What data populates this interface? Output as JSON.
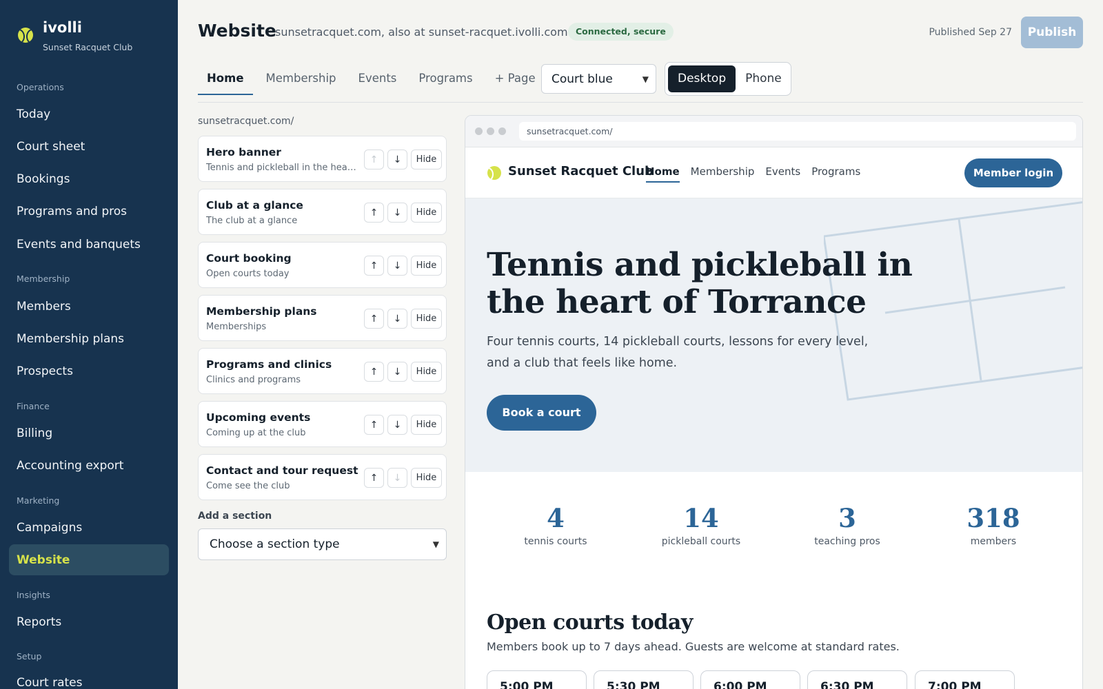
{
  "app": {
    "brand_name": "ivolli",
    "club_name": "Sunset Racquet Club"
  },
  "sidebar": {
    "groups": [
      "Operations",
      "Membership",
      "Finance",
      "Marketing",
      "Insights",
      "Setup"
    ],
    "items": [
      {
        "label": "Today",
        "active": false
      },
      {
        "label": "Court sheet",
        "active": false
      },
      {
        "label": "Bookings",
        "active": false
      },
      {
        "label": "Programs and pros",
        "active": false
      },
      {
        "label": "Events and banquets",
        "active": false
      },
      {
        "label": "Members",
        "active": false
      },
      {
        "label": "Membership plans",
        "active": false
      },
      {
        "label": "Prospects",
        "active": false
      },
      {
        "label": "Billing",
        "active": false
      },
      {
        "label": "Accounting export",
        "active": false
      },
      {
        "label": "Campaigns",
        "active": false
      },
      {
        "label": "Website",
        "active": true
      },
      {
        "label": "Reports",
        "active": false
      },
      {
        "label": "Court rates",
        "active": false
      }
    ]
  },
  "header": {
    "title": "Website",
    "domains": "sunsetracquet.com, also at sunset-racquet.ivolli.com",
    "status": "Connected, secure",
    "published": "Published Sep 27",
    "publish_label": "Publish"
  },
  "page_tabs": [
    {
      "label": "Home",
      "active": true
    },
    {
      "label": "Membership",
      "active": false
    },
    {
      "label": "Events",
      "active": false
    },
    {
      "label": "Programs",
      "active": false
    },
    {
      "label": "+ Page",
      "active": false
    }
  ],
  "theme": {
    "selected": "Court blue"
  },
  "view_toggle": {
    "options": [
      {
        "label": "Desktop",
        "active": true
      },
      {
        "label": "Phone",
        "active": false
      }
    ]
  },
  "sections": {
    "path": "sunsetracquet.com/",
    "hide_label": "Hide",
    "items": [
      {
        "title": "Hero banner",
        "subtitle": "Tennis and pickleball in the heart o...",
        "can_up": false,
        "can_down": true
      },
      {
        "title": "Club at a glance",
        "subtitle": "The club at a glance",
        "can_up": true,
        "can_down": true
      },
      {
        "title": "Court booking",
        "subtitle": "Open courts today",
        "can_up": true,
        "can_down": true
      },
      {
        "title": "Membership plans",
        "subtitle": "Memberships",
        "can_up": true,
        "can_down": true
      },
      {
        "title": "Programs and clinics",
        "subtitle": "Clinics and programs",
        "can_up": true,
        "can_down": true
      },
      {
        "title": "Upcoming events",
        "subtitle": "Coming up at the club",
        "can_up": true,
        "can_down": true
      },
      {
        "title": "Contact and tour request",
        "subtitle": "Come see the club",
        "can_up": true,
        "can_down": false
      }
    ],
    "add_label": "Add a section",
    "add_placeholder": "Choose a section type"
  },
  "preview": {
    "url": "sunsetracquet.com/",
    "site_name": "Sunset Racquet Club",
    "nav": [
      {
        "label": "Home",
        "active": true
      },
      {
        "label": "Membership",
        "active": false
      },
      {
        "label": "Events",
        "active": false
      },
      {
        "label": "Programs",
        "active": false
      }
    ],
    "member_login": "Member login",
    "hero_title": "Tennis and pickleball in the heart of Torrance",
    "hero_sub": "Four tennis courts, 14 pickleball courts, lessons for every level, and a club that feels like home.",
    "hero_cta": "Book a court",
    "stats": [
      {
        "value": "4",
        "label": "tennis courts"
      },
      {
        "value": "14",
        "label": "pickleball courts"
      },
      {
        "value": "3",
        "label": "teaching pros"
      },
      {
        "value": "318",
        "label": "members"
      }
    ],
    "courts_title": "Open courts today",
    "courts_sub": "Members book up to 7 days ahead. Guests are welcome at standard rates.",
    "slots": [
      "5:00 PM",
      "5:30 PM",
      "6:00 PM",
      "6:30 PM",
      "7:00 PM"
    ]
  },
  "colors": {
    "sidebar_bg": "#17334f",
    "accent_yellow": "#d6e24a",
    "brand_blue": "#2c6597",
    "publish_disabled": "#a3bdd6"
  }
}
